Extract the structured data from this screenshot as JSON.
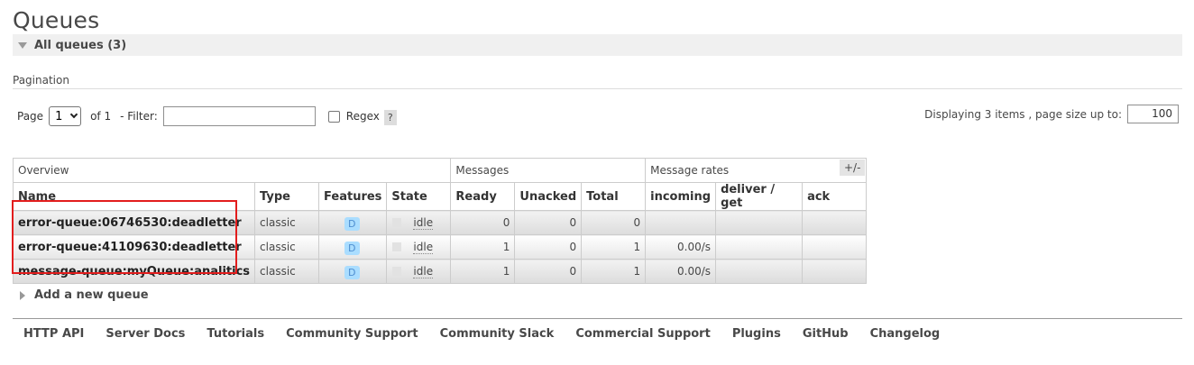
{
  "page": {
    "title": "Queues"
  },
  "section": {
    "title": "All queues (3)"
  },
  "pagination": {
    "label": "Pagination",
    "page_label": "Page",
    "page_value": "1",
    "of_label": "of 1",
    "filter_label": "- Filter:",
    "filter_value": "",
    "regex_label": "Regex",
    "help_label": "?",
    "displaying_text": "Displaying 3 items , page size up to:",
    "page_size_value": "100"
  },
  "table": {
    "group_headers": {
      "overview": "Overview",
      "messages": "Messages",
      "message_rates": "Message rates"
    },
    "columns": [
      "Name",
      "Type",
      "Features",
      "State",
      "Ready",
      "Unacked",
      "Total",
      "incoming",
      "deliver / get",
      "ack"
    ],
    "toggle_label": "+/-",
    "rows": [
      {
        "name": "error-queue:06746530:deadletter",
        "type": "classic",
        "feature": "D",
        "state": "idle",
        "ready": "0",
        "unacked": "0",
        "total": "0",
        "incoming": "",
        "deliver_get": "",
        "ack": ""
      },
      {
        "name": "error-queue:41109630:deadletter",
        "type": "classic",
        "feature": "D",
        "state": "idle",
        "ready": "1",
        "unacked": "0",
        "total": "1",
        "incoming": "0.00/s",
        "deliver_get": "",
        "ack": ""
      },
      {
        "name": "message-queue:myQueue:analitics",
        "type": "classic",
        "feature": "D",
        "state": "idle",
        "ready": "1",
        "unacked": "0",
        "total": "1",
        "incoming": "0.00/s",
        "deliver_get": "",
        "ack": ""
      }
    ]
  },
  "add_queue": {
    "label": "Add a new queue"
  },
  "footer": {
    "links": [
      "HTTP API",
      "Server Docs",
      "Tutorials",
      "Community Support",
      "Community Slack",
      "Commercial Support",
      "Plugins",
      "GitHub",
      "Changelog"
    ]
  },
  "colors": {
    "highlight_border": "#e21d1d",
    "feature_badge_bg": "#aaddff",
    "feature_badge_text": "#4e8ed0"
  }
}
